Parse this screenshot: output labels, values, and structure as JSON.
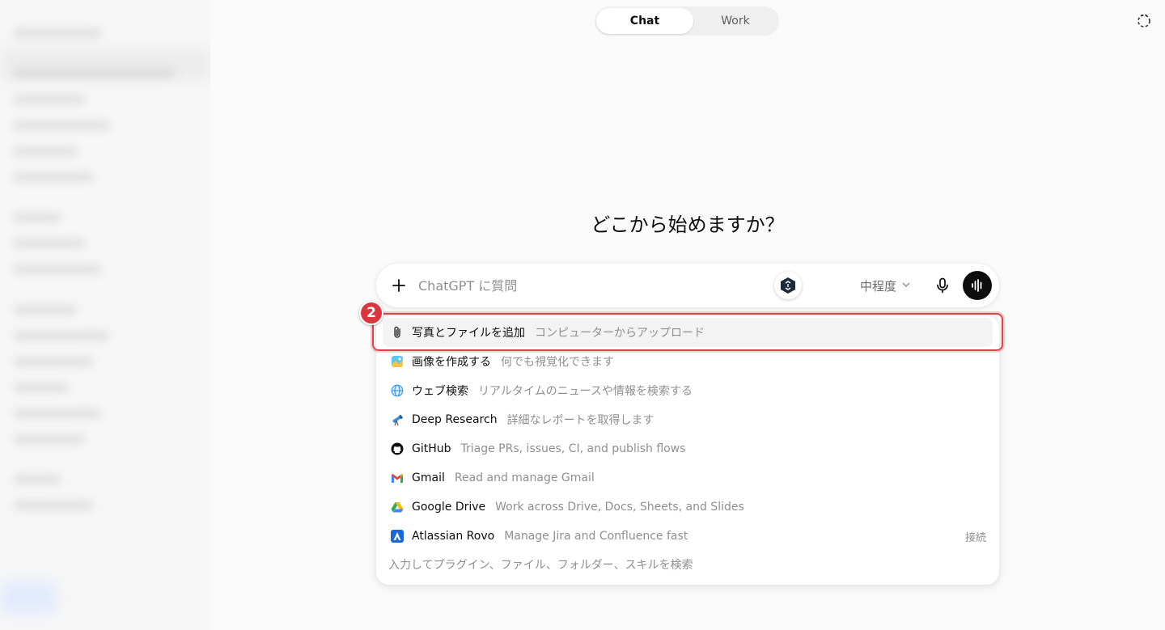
{
  "mode_switch": {
    "chat_label": "Chat",
    "work_label": "Work",
    "active": "Chat"
  },
  "heading": "どこから始めますか？",
  "composer": {
    "placeholder": "ChatGPT に質問",
    "effort_label": "中程度",
    "icons": {
      "add": "plus-icon",
      "extension": "extension-icon",
      "dropdown": "chevron-down-icon",
      "mic": "microphone-icon",
      "voice": "voice-mode-icon"
    }
  },
  "menu": {
    "items": [
      {
        "label": "写真とファイルを追加",
        "description": "コンピューターからアップロード",
        "icon": "paperclip-icon",
        "highlighted": true
      },
      {
        "label": "画像を作成する",
        "description": "何でも視覚化できます",
        "icon": "image-create-icon"
      },
      {
        "label": "ウェブ検索",
        "description": "リアルタイムのニュースや情報を検索する",
        "icon": "globe-icon"
      },
      {
        "label": "Deep Research",
        "description": "詳細なレポートを取得します",
        "icon": "telescope-icon"
      },
      {
        "label": "GitHub",
        "description": "Triage PRs, issues, CI, and publish flows",
        "icon": "github-icon"
      },
      {
        "label": "Gmail",
        "description": "Read and manage Gmail",
        "icon": "gmail-icon"
      },
      {
        "label": "Google Drive",
        "description": "Work across Drive, Docs, Sheets, and Slides",
        "icon": "google-drive-icon"
      },
      {
        "label": "Atlassian Rovo",
        "description": "Manage Jira and Confluence fast",
        "icon": "atlassian-icon",
        "action": "接続"
      }
    ],
    "footer": "入力してプラグイン、ファイル、フォルダー、スキルを検索"
  },
  "annotation": {
    "number": "2",
    "color": "#e0444b"
  }
}
